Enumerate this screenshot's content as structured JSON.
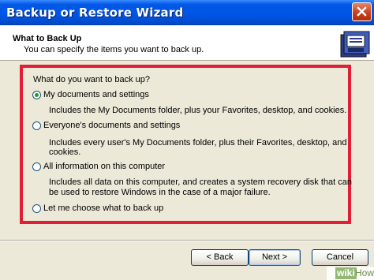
{
  "window": {
    "title": "Backup or Restore Wizard"
  },
  "header": {
    "title": "What to Back Up",
    "subtitle": "You can specify the items you want to back up."
  },
  "question": "What do you want to back up?",
  "options": [
    {
      "label": "My documents and settings",
      "description": [
        "Includes the My Documents folder, plus your Favorites, desktop, and cookies."
      ],
      "selected": true
    },
    {
      "label": "Everyone's documents and settings",
      "description": [
        "Includes every user's My Documents folder, plus their Favorites, desktop, and cookies."
      ],
      "selected": false
    },
    {
      "label": "All information on this computer",
      "description": [
        "Includes all data on this computer, and creates a system recovery disk that can",
        "be used to restore Windows in the case of a major failure."
      ],
      "selected": false
    },
    {
      "label": "Let me choose what to back up",
      "description": [],
      "selected": false
    }
  ],
  "buttons": {
    "back": "< Back",
    "next": "Next >",
    "cancel": "Cancel"
  },
  "watermark": {
    "wiki": "wiki",
    "how": "How"
  },
  "colors": {
    "titlebar": "#0055E5",
    "highlight_border": "#E01E36",
    "radio_selected": "#21A121",
    "dialog_bg": "#ECE9D8"
  }
}
